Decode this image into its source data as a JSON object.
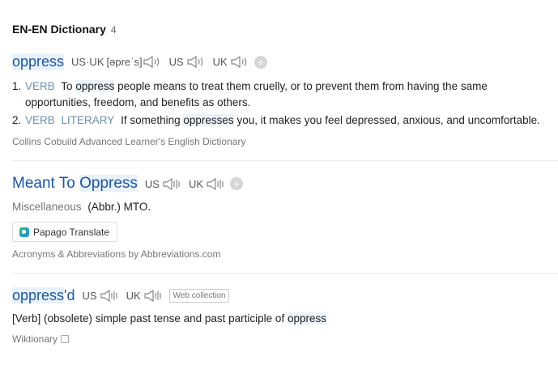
{
  "header": {
    "title": "EN-EN Dictionary",
    "count": "4"
  },
  "collins": {
    "headword": "oppress",
    "phonetic_label": "US·UK",
    "phonetic": "[əpreˈs]",
    "us_label": "US",
    "uk_label": "UK",
    "definitions": [
      {
        "num": "1.",
        "pos": "VERB",
        "pre": "To",
        "hl": "oppress",
        "post": "people means to treat them cruelly, or to prevent them from having the same opportunities, freedom, and benefits as others."
      },
      {
        "num": "2.",
        "pos": "VERB",
        "register": "LITERARY",
        "pre": "If something",
        "hl": "oppresses",
        "post": "you, it makes you feel depressed, anxious, and uncomfortable."
      }
    ],
    "source": "Collins Cobuild Advanced Learner's English Dictionary"
  },
  "abbr": {
    "headword_pre": "Meant To",
    "headword_hl": "Oppress",
    "us_label": "US",
    "uk_label": "UK",
    "category": "Miscellaneous",
    "meaning": "(Abbr.) MTO.",
    "translate_button": "Papago Translate",
    "source": "Acronyms & Abbreviations by Abbreviations.com"
  },
  "wiktionary": {
    "headword_hl": "oppress",
    "headword_suffix": "'d",
    "us_label": "US",
    "uk_label": "UK",
    "tag": "Web collection",
    "pre": "[Verb] (obsolete) simple past tense and past participle of",
    "hl": "oppress",
    "source": "Wiktionary"
  }
}
